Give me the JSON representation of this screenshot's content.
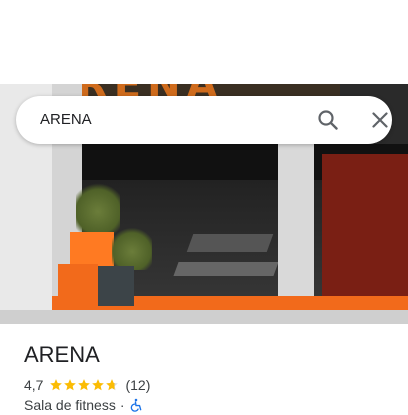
{
  "search": {
    "query": "ARENA"
  },
  "hero": {
    "sign_text": "ARENA"
  },
  "place": {
    "name": "ARENA",
    "rating": "4,7",
    "rating_value": 4.7,
    "stars_total": 5,
    "review_count": "(12)",
    "category": "Sala de fitness",
    "separator": "·",
    "accessibility_icon": "wheelchair-accessible-icon"
  },
  "colors": {
    "star": "#fbbc04",
    "accessibility": "#1a73e8",
    "accent_orange": "#f26a1b"
  }
}
